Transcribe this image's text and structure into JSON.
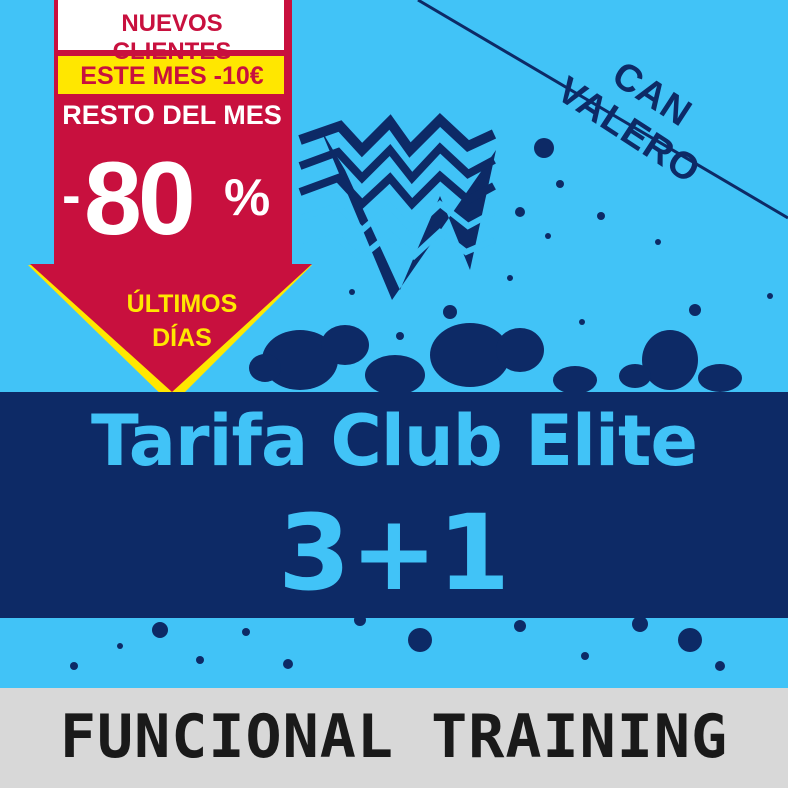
{
  "promo": {
    "line1": "NUEVOS CLIENTES",
    "line2": "ESTE MES -10€",
    "line3": "RESTO DEL MES",
    "discount_minus": "-",
    "discount_value": "80",
    "discount_sign": "%",
    "line5": "ÚLTIMOS",
    "line6": "DÍAS"
  },
  "location": "CAN VALERO",
  "title": "Tarifa Club Elite",
  "subtitle": "3+1",
  "footer": "FUNCIONAL TRAINING",
  "logo_name": "mountain-logo",
  "colors": {
    "background": "#41c3f7",
    "navy": "#0d2a66",
    "red": "#c8103e",
    "yellow": "#ffe700",
    "gray": "#d8d8d8"
  }
}
